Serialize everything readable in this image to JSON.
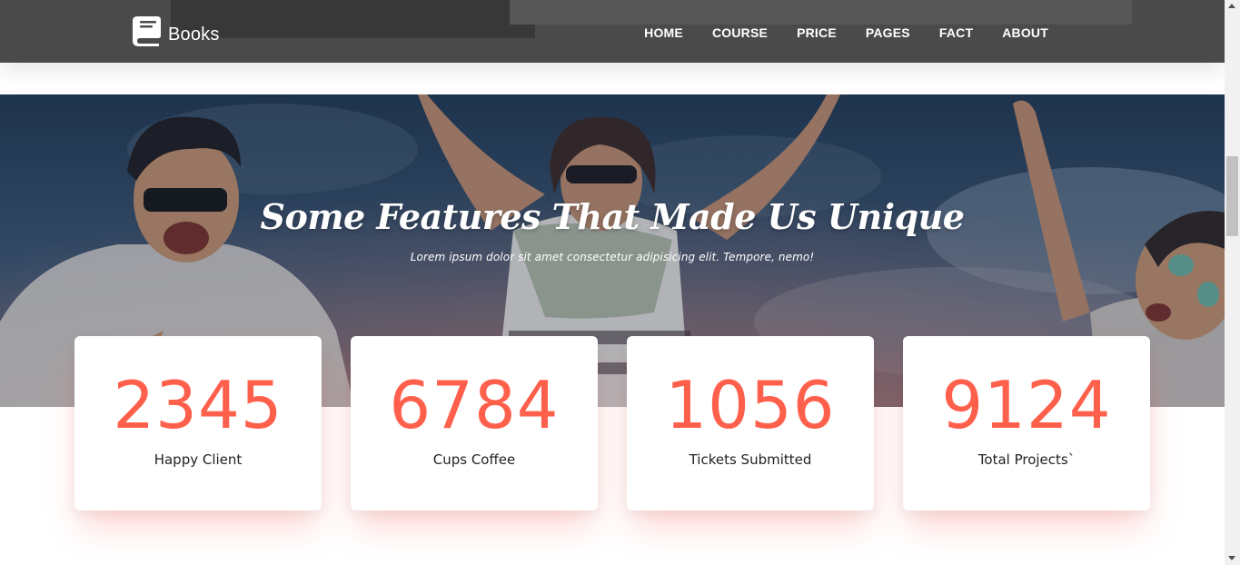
{
  "brand": {
    "name": "Books",
    "icon": "book-icon"
  },
  "nav": {
    "items": [
      "HOME",
      "COURSE",
      "PRICE",
      "PAGES",
      "FACT",
      "ABOUT"
    ]
  },
  "hero": {
    "title": "Some Features That Made Us Unique",
    "subtitle": "Lorem ipsum dolor sit amet consectetur adipisicing elit. Tempore, nemo!"
  },
  "stats": [
    {
      "value": "2345",
      "label": "Happy Client"
    },
    {
      "value": "6784",
      "label": "Cups Coffee"
    },
    {
      "value": "1056",
      "label": "Tickets Submitted"
    },
    {
      "value": "9124",
      "label": "Total Projects`"
    }
  ],
  "colors": {
    "accent": "#ff604c",
    "navbar": "#4a4a4a",
    "hero_overlay": "#2f4257"
  }
}
